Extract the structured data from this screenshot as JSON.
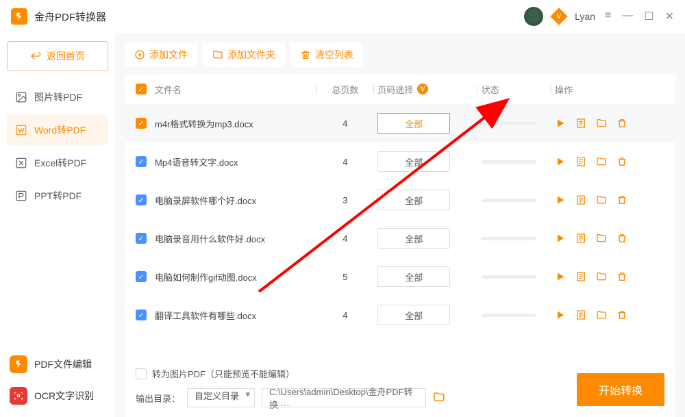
{
  "app": {
    "title": "金舟PDF转换器",
    "username": "Lyan"
  },
  "sidebar": {
    "back_label": "返回首页",
    "nav": [
      {
        "label": "图片转PDF"
      },
      {
        "label": "Word转PDF"
      },
      {
        "label": "Excel转PDF"
      },
      {
        "label": "PPT转PDF"
      }
    ],
    "tools": [
      {
        "label": "PDF文件编辑"
      },
      {
        "label": "OCR文字识别"
      }
    ]
  },
  "toolbar": {
    "add_file": "添加文件",
    "add_folder": "添加文件夹",
    "clear_list": "清空列表"
  },
  "table": {
    "headers": {
      "name": "文件名",
      "pages": "总页数",
      "range": "页码选择",
      "status": "状态",
      "actions": "操作"
    },
    "rows": [
      {
        "name": "m4r格式转换为mp3.docx",
        "pages": "4",
        "range": "全部",
        "highlight": true,
        "active_range": true
      },
      {
        "name": "Mp4语音转文字.docx",
        "pages": "4",
        "range": "全部"
      },
      {
        "name": "电脑录屏软件哪个好.docx",
        "pages": "3",
        "range": "全部"
      },
      {
        "name": "电脑录音用什么软件好.docx",
        "pages": "4",
        "range": "全部"
      },
      {
        "name": "电脑如何制作gif动图.docx",
        "pages": "5",
        "range": "全部"
      },
      {
        "name": "翻译工具软件有哪些.docx",
        "pages": "4",
        "range": "全部"
      }
    ]
  },
  "footer": {
    "img_pdf_label": "转为图片PDF（只能预览不能编辑）",
    "output_label": "输出目录：",
    "output_mode": "自定义目录",
    "output_path": "C:\\Users\\admin\\Desktop\\金舟PDF转换 ···",
    "start_label": "开始转换"
  }
}
